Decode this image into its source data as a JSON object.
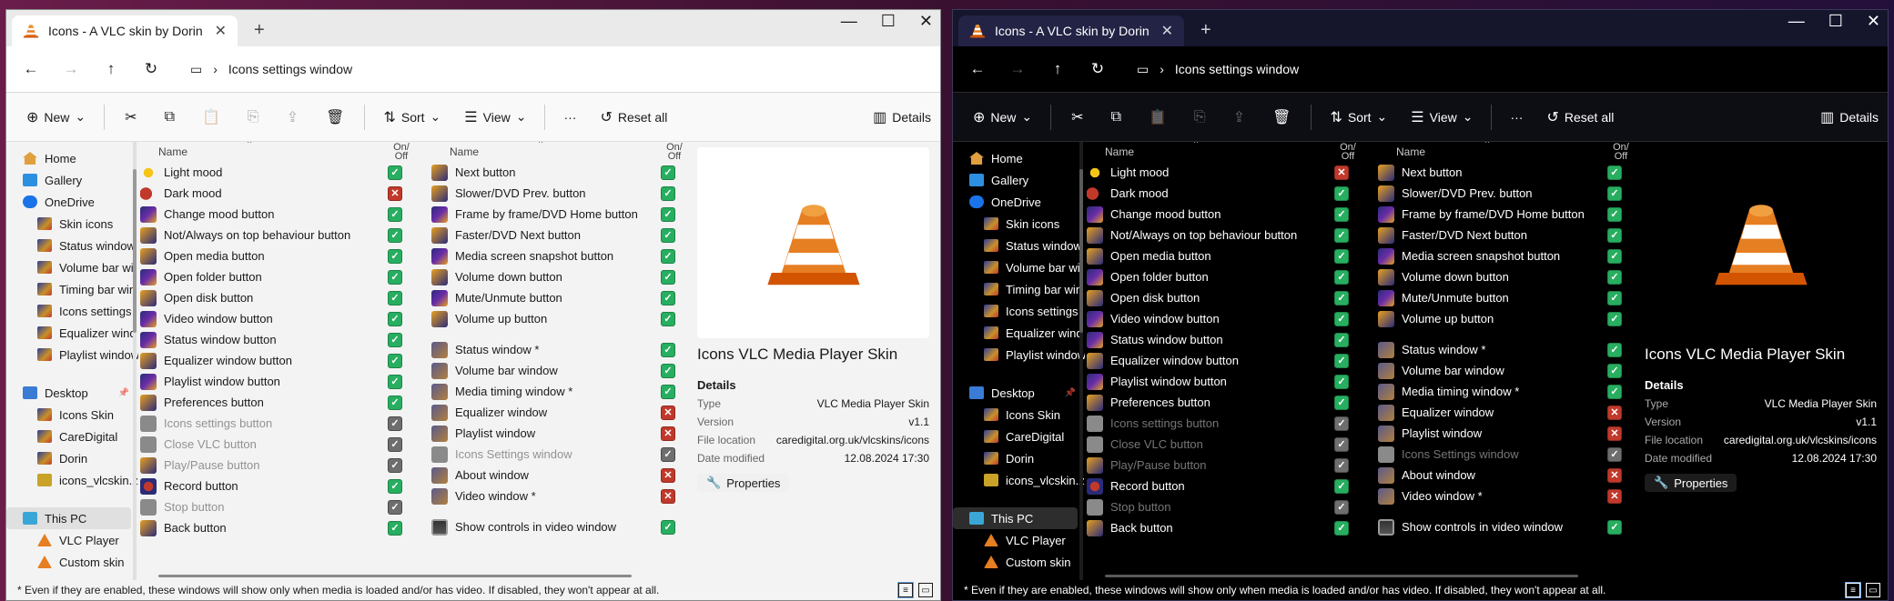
{
  "window": {
    "tab_title": "Icons - A VLC skin by Dorin",
    "tab_close": "✕",
    "new_tab": "+",
    "minimize": "—",
    "maximize": "☐",
    "close": "✕"
  },
  "nav": {
    "back": "←",
    "forward": "→",
    "up": "↑",
    "refresh": "↻",
    "breadcrumb_sep": "›",
    "path": "Icons settings window"
  },
  "toolbar": {
    "new": "New",
    "sort": "Sort",
    "view": "View",
    "more": "···",
    "reset_all": "Reset all",
    "details": "Details"
  },
  "sidebar": {
    "items": [
      {
        "label": "Home",
        "icon": "home-icon"
      },
      {
        "label": "Gallery",
        "icon": "gallery-icon"
      },
      {
        "label": "OneDrive",
        "icon": "onedrive-icon"
      },
      {
        "label": "Skin icons",
        "icon": "folder-icon"
      },
      {
        "label": "Status window",
        "icon": "folder-icon"
      },
      {
        "label": "Volume bar wi",
        "icon": "folder-icon"
      },
      {
        "label": "Timing bar win",
        "icon": "folder-icon"
      },
      {
        "label": "Icons settings",
        "icon": "folder-icon"
      },
      {
        "label": "Equalizer wind",
        "icon": "folder-icon"
      },
      {
        "label": "Playlist window",
        "icon": "folder-icon"
      },
      {
        "label": "Desktop",
        "icon": "desktop-icon"
      },
      {
        "label": "Icons Skin",
        "icon": "folder-icon"
      },
      {
        "label": "CareDigital",
        "icon": "folder-icon"
      },
      {
        "label": "Dorin",
        "icon": "folder-icon"
      },
      {
        "label": "icons_vlcskin.zip",
        "icon": "zip-icon"
      },
      {
        "label": "This PC",
        "icon": "pc-icon"
      },
      {
        "label": "VLC Player",
        "icon": "vlc-icon"
      },
      {
        "label": "Custom skin",
        "icon": "vlc-icon"
      }
    ]
  },
  "columns": {
    "name": "Name",
    "on": "On/",
    "off": "Off",
    "sort_arrow": "^"
  },
  "left_list": [
    {
      "label": "Light mood",
      "state": "on",
      "dark_state": "off",
      "icon": "sun"
    },
    {
      "label": "Dark mood",
      "state": "off",
      "dark_state": "on",
      "icon": "moon"
    },
    {
      "label": "Change mood button",
      "state": "on",
      "icon": "btn"
    },
    {
      "label": "Not/Always on top behaviour button",
      "state": "on",
      "icon": "btn2"
    },
    {
      "label": "Open media button",
      "state": "on",
      "icon": "btn2"
    },
    {
      "label": "Open folder button",
      "state": "on",
      "icon": "btn"
    },
    {
      "label": "Open disk button",
      "state": "on",
      "icon": "btn2"
    },
    {
      "label": "Video window button",
      "state": "on",
      "icon": "btn"
    },
    {
      "label": "Status window button",
      "state": "on",
      "icon": "btn"
    },
    {
      "label": "Equalizer window button",
      "state": "on",
      "icon": "btn2"
    },
    {
      "label": "Playlist window button",
      "state": "on",
      "icon": "btn"
    },
    {
      "label": "Preferences button",
      "state": "on",
      "icon": "btn2"
    },
    {
      "label": "Icons settings button",
      "state": "gray",
      "icon": "gray",
      "disabled": true
    },
    {
      "label": "Close VLC button",
      "state": "gray",
      "icon": "gray",
      "disabled": true
    },
    {
      "label": "Play/Pause button",
      "state": "gray",
      "icon": "btn2",
      "disabled": true
    },
    {
      "label": "Record button",
      "state": "on",
      "icon": "rec"
    },
    {
      "label": "Stop button",
      "state": "gray",
      "icon": "gray",
      "disabled": true
    },
    {
      "label": "Back button",
      "state": "on",
      "icon": "btn2"
    }
  ],
  "right_list": [
    {
      "label": "Next button",
      "state": "on",
      "icon": "btn2"
    },
    {
      "label": "Slower/DVD Prev. button",
      "state": "on",
      "icon": "btn2"
    },
    {
      "label": "Frame by frame/DVD Home button",
      "state": "on",
      "icon": "btn"
    },
    {
      "label": "Faster/DVD Next button",
      "state": "on",
      "icon": "btn2"
    },
    {
      "label": "Media screen snapshot button",
      "state": "on",
      "icon": "btn"
    },
    {
      "label": "Volume down button",
      "state": "on",
      "icon": "btn2"
    },
    {
      "label": "Mute/Unmute button",
      "state": "on",
      "icon": "btn"
    },
    {
      "label": "Volume up button",
      "state": "on",
      "icon": "btn2"
    },
    {
      "gap": true
    },
    {
      "label": "Status window *",
      "state": "on",
      "icon": "win"
    },
    {
      "label": "Volume bar window",
      "state": "on",
      "icon": "win"
    },
    {
      "label": "Media timing window *",
      "state": "on",
      "icon": "win"
    },
    {
      "label": "Equalizer window",
      "state": "off",
      "icon": "win"
    },
    {
      "label": "Playlist window",
      "state": "off",
      "icon": "win"
    },
    {
      "label": "Icons Settings window",
      "state": "gray",
      "icon": "gray",
      "disabled": true
    },
    {
      "label": "About window",
      "state": "off",
      "icon": "win"
    },
    {
      "label": "Video window *",
      "state": "off",
      "icon": "win"
    },
    {
      "gap": true
    },
    {
      "label": "Show controls in video window",
      "state": "on",
      "icon": "screen"
    }
  ],
  "details": {
    "title": "Icons VLC Media Player Skin",
    "section": "Details",
    "type_k": "Type",
    "type_v": "VLC Media Player Skin",
    "version_k": "Version",
    "version_v": "v1.1",
    "location_k": "File location",
    "location_v": "caredigital.org.uk/vlcskins/icons",
    "modified_k": "Date modified",
    "modified_v": "12.08.2024   17:30",
    "properties": "Properties"
  },
  "status": {
    "note": "* Even if they are enabled, these windows will show only when media is loaded and/or has video. If disabled, they won't appear at all."
  },
  "colors": {
    "check_on": "#27ae60",
    "check_off": "#c0392b",
    "check_gray": "#6e6e6e",
    "vlc_orange": "#e67e22"
  }
}
